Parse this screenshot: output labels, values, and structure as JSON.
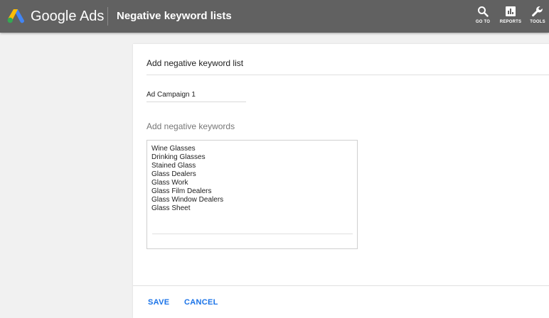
{
  "header": {
    "brand": "Google Ads",
    "page_title": "Negative keyword lists",
    "nav": [
      {
        "label": "GO TO",
        "icon": "search-icon"
      },
      {
        "label": "REPORTS",
        "icon": "reports-icon"
      },
      {
        "label": "TOOLS",
        "icon": "wrench-icon"
      }
    ]
  },
  "form": {
    "title": "Add negative keyword list",
    "list_name_value": "Ad Campaign 1",
    "keywords_label": "Add negative keywords",
    "keywords": [
      "Wine Glasses",
      "Drinking Glasses",
      "Stained Glass",
      "Glass Dealers",
      "Glass Work",
      "Glass Film Dealers",
      "Glass Window Dealers",
      "Glass Sheet"
    ]
  },
  "actions": {
    "save_label": "SAVE",
    "cancel_label": "CANCEL"
  },
  "colors": {
    "header_bg": "#616161",
    "action_blue": "#1a73e8",
    "logo_yellow": "#fbbc04",
    "logo_blue": "#4285f4",
    "logo_green": "#34a853"
  }
}
